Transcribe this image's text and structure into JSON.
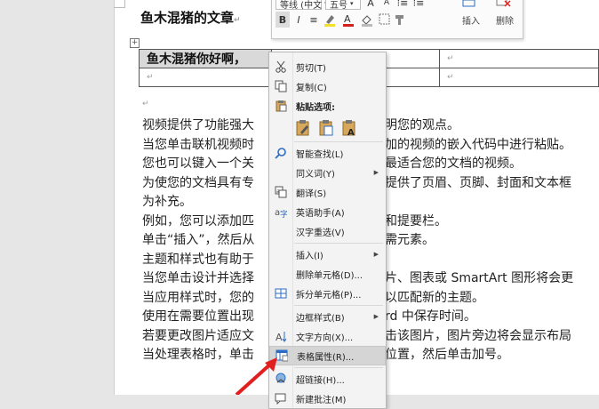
{
  "document": {
    "title": "鱼木混猪的文章",
    "table_cell_selected": "鱼木混猪你好啊，",
    "lines": [
      {
        "left": "视频提供了功能强大",
        "right": "明您的观点。"
      },
      {
        "left": "当您单击联机视频时",
        "right": "加的视频的嵌入代码中进行粘贴。"
      },
      {
        "left": "您也可以键入一个关",
        "right": "最适合您的文档的视频。"
      },
      {
        "left": "为使您的文档具有专",
        "right": "提供了页眉、页脚、封面和文本框"
      },
      {
        "left": "为补充。",
        "right": ""
      },
      {
        "left": "例如，您可以添加匹",
        "right": "和提要栏。"
      },
      {
        "left": "单击“插入”，然后从",
        "right": "需元素。"
      },
      {
        "left": "主题和样式也有助于",
        "right": ""
      },
      {
        "left": "当您单击设计并选择",
        "right": "片、图表或 SmartArt 图形将会更"
      },
      {
        "left": "当应用样式时，您的",
        "right": "以匹配新的主题。"
      },
      {
        "left": "使用在需要位置出现",
        "right": "rd 中保存时间。"
      },
      {
        "left": "若要更改图片适应文",
        "right": "击该图片，图片旁边将会显示布局"
      },
      {
        "left": "当处理表格时，单击",
        "right": "位置，然后单击加号。"
      }
    ]
  },
  "mini_toolbar": {
    "font": "等线 (中文",
    "size": "五号",
    "grow": "A",
    "shrink": "A",
    "bold": "B",
    "italic": "I",
    "align": "≡",
    "insert_label": "插入",
    "delete_label": "删除"
  },
  "context_menu": {
    "cut": "剪切(T)",
    "copy": "复制(C)",
    "paste_options": "粘贴选项:",
    "smart_lookup": "智能查找(L)",
    "synonyms": "同义词(Y)",
    "translate": "翻译(S)",
    "english_assistant": "英语助手(A)",
    "hanzi_reselect": "汉字重选(V)",
    "insert": "插入(I)",
    "delete_cells": "删除单元格(D)...",
    "split_cells": "拆分单元格(P)...",
    "border_styles": "边框样式(B)",
    "text_direction": "文字方向(X)...",
    "table_properties": "表格属性(R)...",
    "hyperlink": "超链接(H)...",
    "new_comment": "新建批注(M)"
  },
  "colors": {
    "highlight": "#d5d5d5",
    "accent_blue": "#2b6cc4",
    "arrow_red": "#e02020",
    "font_color_red": "#d02020",
    "highlight_yellow": "#f3e02a"
  }
}
